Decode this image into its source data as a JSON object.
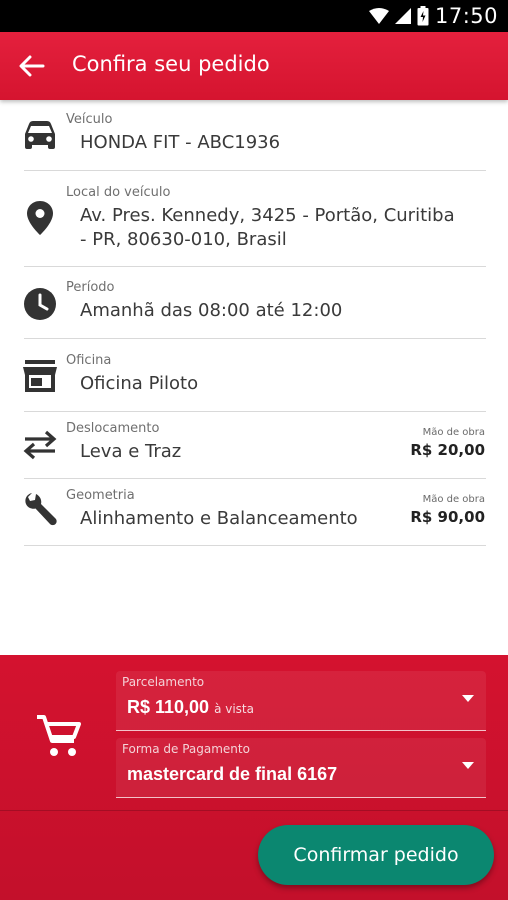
{
  "status_bar": {
    "time": "17:50"
  },
  "app_bar": {
    "title": "Confira seu pedido"
  },
  "vehicle": {
    "label": "Veículo",
    "value": "HONDA FIT - ABC1936"
  },
  "location": {
    "label": "Local do veículo",
    "value_line1": "Av. Pres. Kennedy, 3425 - Portão, Curitiba",
    "value_line2": "- PR, 80630-010, Brasil"
  },
  "period": {
    "label": "Período",
    "value": "Amanhã das 08:00 até 12:00"
  },
  "workshop": {
    "label": "Oficina",
    "value": "Oficina Piloto"
  },
  "displacement": {
    "label": "Deslocamento",
    "value": "Leva e Traz",
    "price_caption": "Mão de obra",
    "price": "R$ 20,00"
  },
  "geometry": {
    "label": "Geometria",
    "value": "Alinhamento e Balanceamento",
    "price_caption": "Mão de obra",
    "price": "R$ 90,00"
  },
  "installments": {
    "label": "Parcelamento",
    "value": "R$ 110,00",
    "suffix": "à vista"
  },
  "payment": {
    "label": "Forma de Pagamento",
    "value": "mastercard de final 6167"
  },
  "confirm_button": {
    "label": "Confirmar pedido"
  },
  "colors": {
    "primary": "#d5142f",
    "accent": "#0b8770",
    "icon": "#333333"
  },
  "icons": [
    "wifi-icon",
    "signal-icon",
    "battery-icon",
    "back-arrow-icon",
    "car-icon",
    "location-pin-icon",
    "clock-icon",
    "store-icon",
    "swap-arrows-icon",
    "wrench-icon",
    "cart-icon",
    "dropdown-arrow-icon"
  ]
}
